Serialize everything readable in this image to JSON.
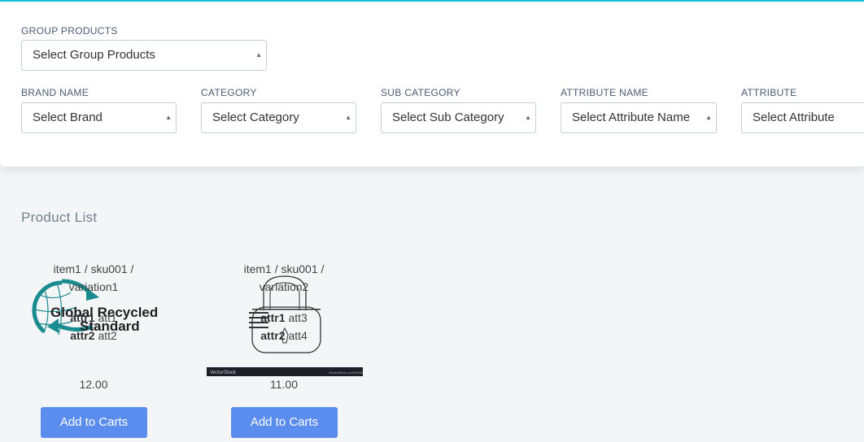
{
  "filters": {
    "group_products": {
      "label": "GROUP PRODUCTS",
      "value": "Select Group Products"
    },
    "brand": {
      "label": "BRAND NAME",
      "value": "Select Brand"
    },
    "category": {
      "label": "CATEGORY",
      "value": "Select Category"
    },
    "sub_category": {
      "label": "SUB CATEGORY",
      "value": "Select Sub Category"
    },
    "attribute_name": {
      "label": "ATTRIBUTE NAME",
      "value": "Select Attribute Name"
    },
    "attribute": {
      "label": "ATTRIBUTE",
      "value": "Select Attribute"
    }
  },
  "product_list": {
    "title": "Product List",
    "products": [
      {
        "name_line1": "item1 / sku001 /",
        "name_line2": "variation1",
        "attr1_name": "attr1",
        "attr1_value": "att1",
        "attr2_name": "attr2",
        "attr2_value": "att2",
        "image_logo": "Global Recycled Standard",
        "price": "12.00",
        "button": "Add to Carts"
      },
      {
        "name_line1": "item1 / sku001 /",
        "name_line2": "variation2",
        "attr1_name": "attr1",
        "attr1_value": "att3",
        "attr2_name": "attr2",
        "attr2_value": "att4",
        "image_logo": "VectorStock",
        "price": "11.00",
        "button": "Add to Carts"
      }
    ]
  },
  "colors": {
    "accent": "#17c1d6",
    "button": "#5b8def"
  }
}
